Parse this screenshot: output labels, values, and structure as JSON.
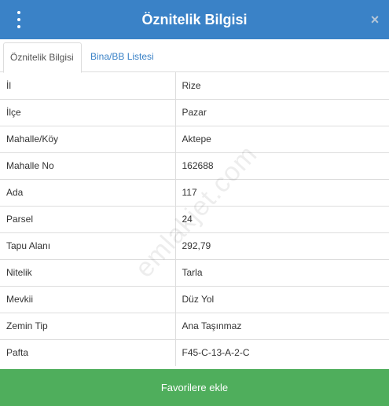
{
  "header": {
    "title": "Öznitelik Bilgisi",
    "menu_icon": "vertical-dots-icon",
    "close_icon": "close-icon",
    "close_glyph": "×"
  },
  "tabs": [
    {
      "label": "Öznitelik Bilgisi",
      "active": true
    },
    {
      "label": "Bina/BB Listesi",
      "active": false
    }
  ],
  "rows": [
    {
      "label": "İl",
      "value": "Rize"
    },
    {
      "label": "İlçe",
      "value": "Pazar"
    },
    {
      "label": "Mahalle/Köy",
      "value": "Aktepe"
    },
    {
      "label": "Mahalle No",
      "value": "162688"
    },
    {
      "label": "Ada",
      "value": "117"
    },
    {
      "label": "Parsel",
      "value": "24"
    },
    {
      "label": "Tapu Alanı",
      "value": "292,79"
    },
    {
      "label": "Nitelik",
      "value": "Tarla"
    },
    {
      "label": "Mevkii",
      "value": "Düz Yol"
    },
    {
      "label": "Zemin Tip",
      "value": "Ana Taşınmaz"
    },
    {
      "label": "Pafta",
      "value": "F45-C-13-A-2-C"
    }
  ],
  "watermark": "emlakjet.com",
  "footer": {
    "favorite_label": "Favorilere ekle"
  },
  "colors": {
    "header": "#3a82c7",
    "button": "#4fae5c",
    "tab_link": "#3a82c7"
  }
}
